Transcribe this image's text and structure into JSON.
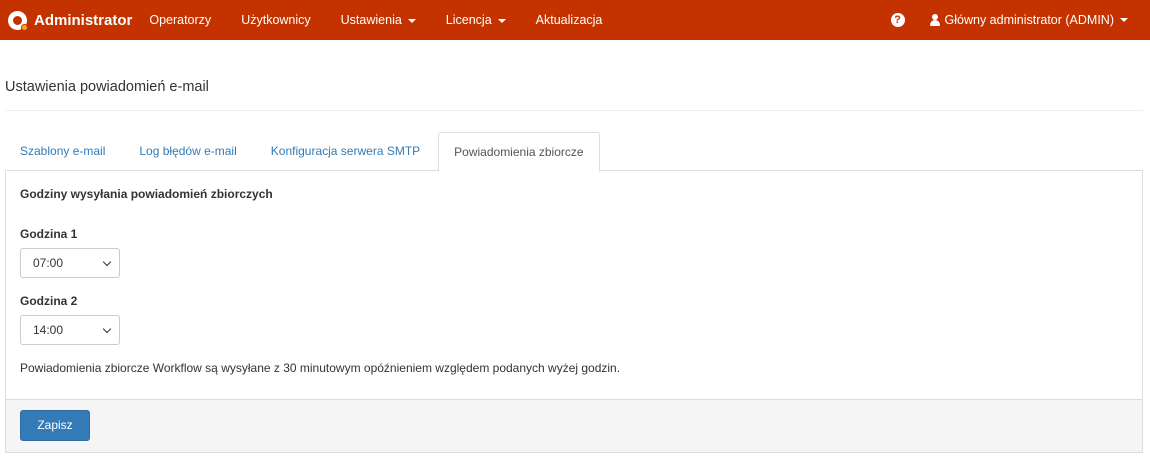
{
  "navbar": {
    "brand": "Administrator",
    "items": [
      {
        "label": "Operatorzy",
        "dropdown": false
      },
      {
        "label": "Użytkownicy",
        "dropdown": false
      },
      {
        "label": "Ustawienia",
        "dropdown": true
      },
      {
        "label": "Licencja",
        "dropdown": true
      },
      {
        "label": "Aktualizacja",
        "dropdown": false
      }
    ],
    "help_icon": "question-circle-icon",
    "user_label": "Główny administrator (ADMIN)",
    "color": "#c43200"
  },
  "page": {
    "title": "Ustawienia powiadomień e-mail"
  },
  "tabs": [
    {
      "label": "Szablony e-mail",
      "active": false
    },
    {
      "label": "Log błędów e-mail",
      "active": false
    },
    {
      "label": "Konfiguracja serwera SMTP",
      "active": false
    },
    {
      "label": "Powiadomienia zbiorcze",
      "active": true
    }
  ],
  "form": {
    "section_title": "Godziny wysyłania powiadomień zbiorczych",
    "hour1_label": "Godzina 1",
    "hour1_value": "07:00",
    "hour2_label": "Godzina 2",
    "hour2_value": "14:00",
    "note": "Powiadomienia zbiorcze Workflow są wysyłane z 30 minutowym opóźnieniem względem podanych wyżej godzin.",
    "save_label": "Zapisz",
    "save_color": "#337ab7"
  }
}
